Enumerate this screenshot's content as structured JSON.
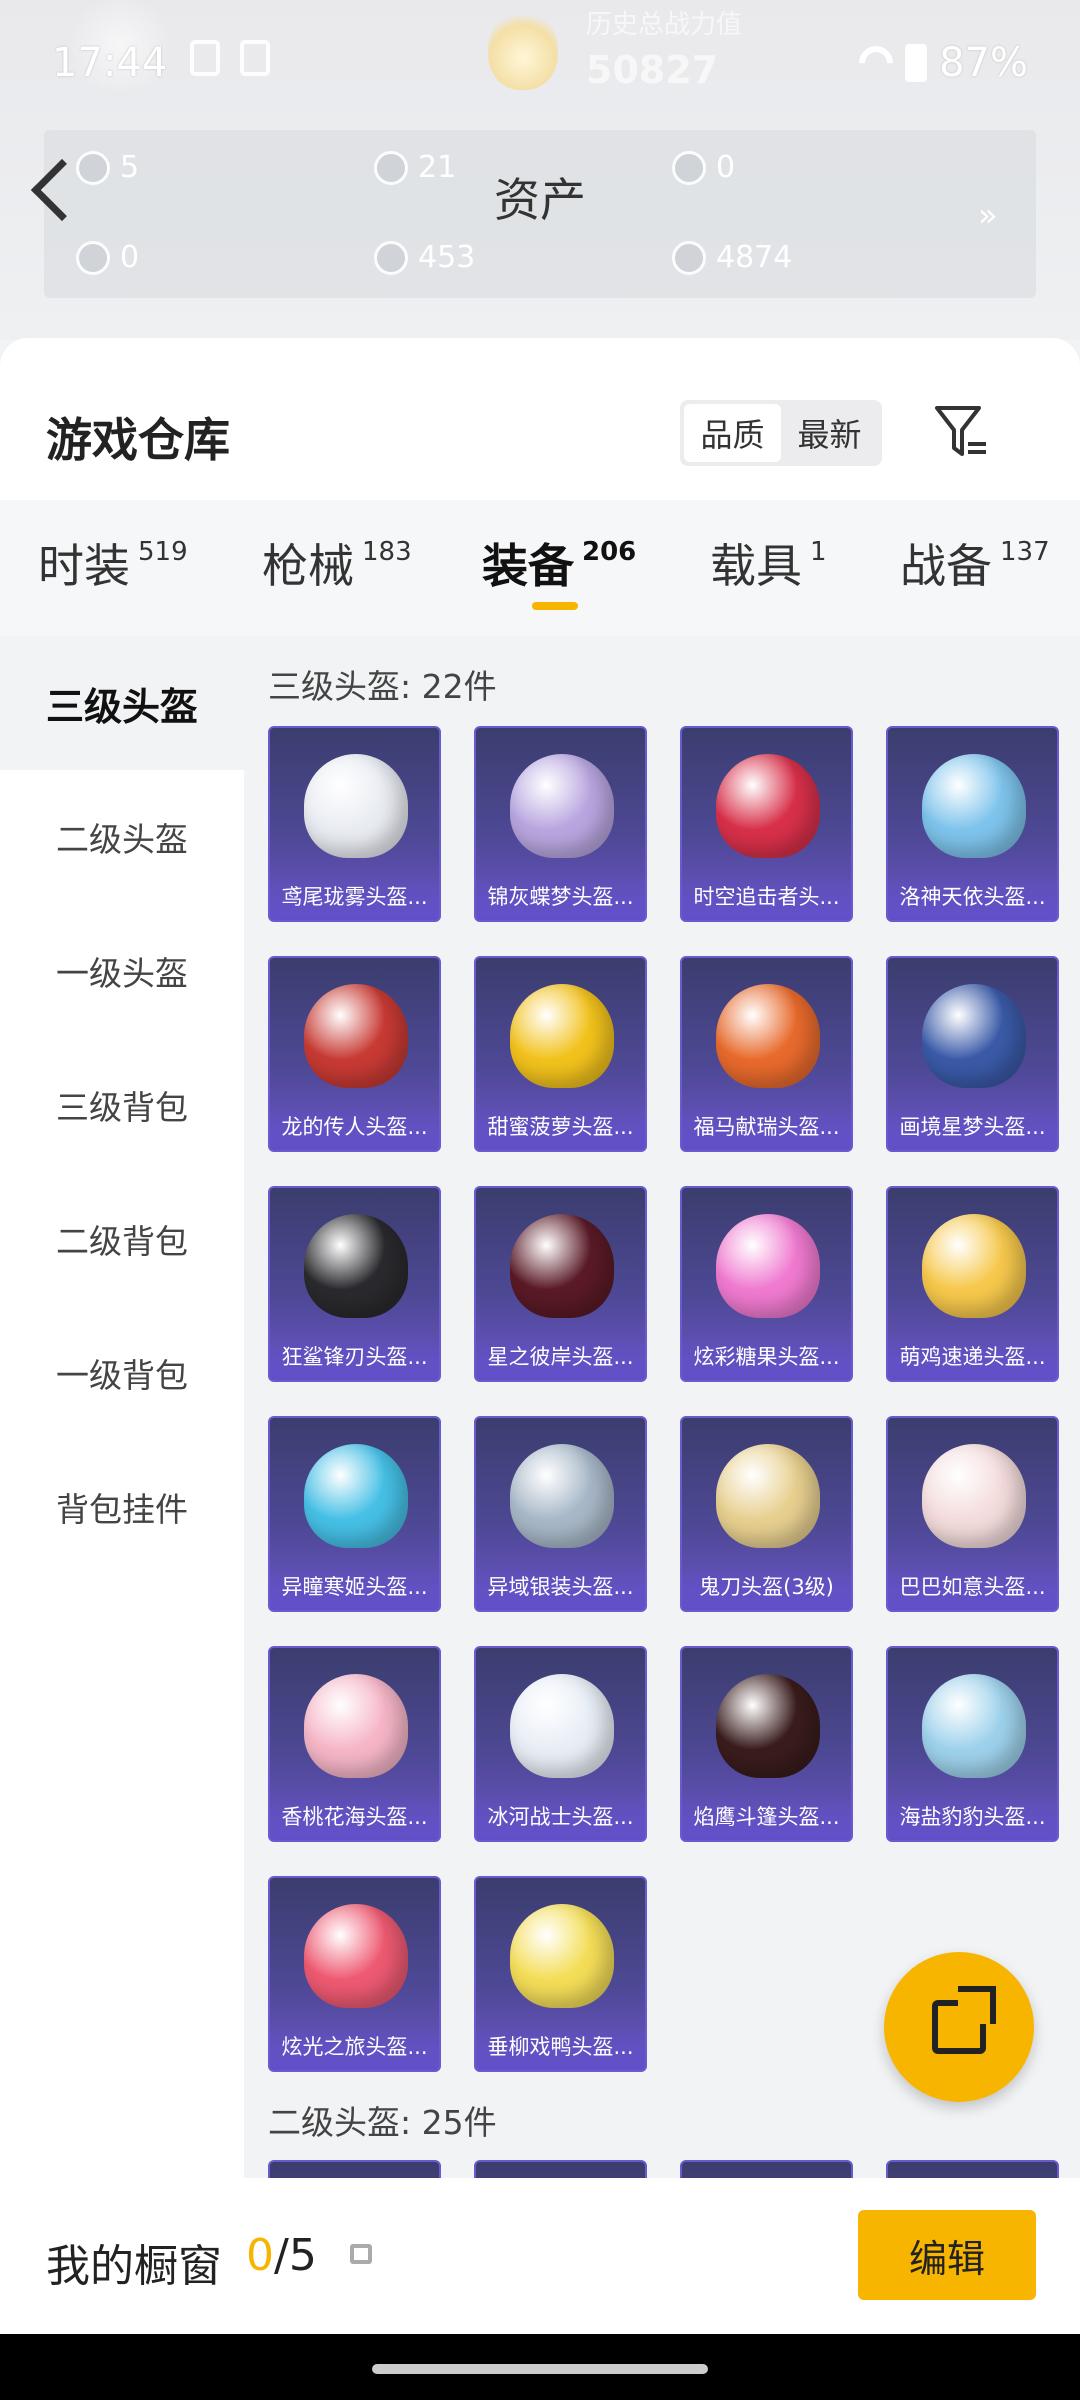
{
  "status": {
    "time": "17:44",
    "battery": "87%"
  },
  "header": {
    "history_label": "历史总战力值",
    "history_value": "50827",
    "asset_title": "资产",
    "assets": [
      {
        "value": "5",
        "icon": "card-icon"
      },
      {
        "value": "21",
        "icon": "coin-icon"
      },
      {
        "value": "0",
        "icon": "badge-icon"
      },
      {
        "value": "0",
        "icon": "ticket-icon"
      },
      {
        "value": "453",
        "icon": "gem-icon"
      },
      {
        "value": "4874",
        "icon": "token-icon"
      }
    ]
  },
  "warehouse": {
    "title": "游戏仓库",
    "sort": {
      "quality": "品质",
      "newest": "最新"
    }
  },
  "tabs": [
    {
      "label": "时装",
      "count": "519"
    },
    {
      "label": "枪械",
      "count": "183"
    },
    {
      "label": "装备",
      "count": "206"
    },
    {
      "label": "载具",
      "count": "1"
    },
    {
      "label": "战备",
      "count": "137"
    }
  ],
  "sidebar": [
    "三级头盔",
    "二级头盔",
    "一级头盔",
    "三级背包",
    "二级背包",
    "一级背包",
    "背包挂件"
  ],
  "sections": {
    "level3_title": "三级头盔: 22件",
    "level2_title": "二级头盔: 25件"
  },
  "items": [
    {
      "name": "鸢尾珑雾头盔...",
      "color": "#e9ecf2"
    },
    {
      "name": "锦灰蝶梦头盔...",
      "color": "#b9a6e0"
    },
    {
      "name": "时空追击者头...",
      "color": "#d8304a"
    },
    {
      "name": "洛神天依头盔...",
      "color": "#7ec4ec"
    },
    {
      "name": "龙的传人头盔...",
      "color": "#c83a34"
    },
    {
      "name": "甜蜜菠萝头盔...",
      "color": "#f2c21c"
    },
    {
      "name": "福马献瑞头盔...",
      "color": "#e86a2c"
    },
    {
      "name": "画境星梦头盔...",
      "color": "#3a5aa8"
    },
    {
      "name": "狂鲨锋刃头盔...",
      "color": "#2a2a2e"
    },
    {
      "name": "星之彼岸头盔...",
      "color": "#5a1a26"
    },
    {
      "name": "炫彩糖果头盔...",
      "color": "#f07ad0"
    },
    {
      "name": "萌鸡速递头盔...",
      "color": "#f6c84c"
    },
    {
      "name": "异瞳寒姬头盔...",
      "color": "#46c0e6"
    },
    {
      "name": "异域银装头盔...",
      "color": "#a8b8c8"
    },
    {
      "name": "鬼刀头盔(3级)",
      "color": "#e8d090"
    },
    {
      "name": "巴巴如意头盔...",
      "color": "#f4dcdc"
    },
    {
      "name": "香桃花海头盔...",
      "color": "#f6b6c8"
    },
    {
      "name": "冰河战士头盔...",
      "color": "#e8eef6"
    },
    {
      "name": "焰鹰斗篷头盔...",
      "color": "#3a1c1c"
    },
    {
      "name": "海盐豹豹头盔...",
      "color": "#9ed2ec"
    },
    {
      "name": "炫光之旅头盔...",
      "color": "#ee5a72"
    },
    {
      "name": "垂柳戏鸭头盔...",
      "color": "#f4de58"
    }
  ],
  "bottom": {
    "window_label": "我的橱窗",
    "used": "0",
    "total": "/5",
    "edit": "编辑"
  },
  "colors": {
    "accent": "#f7b500",
    "tile_bg": "#4d4894"
  }
}
